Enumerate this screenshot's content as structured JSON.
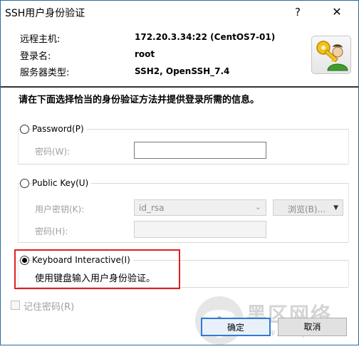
{
  "window": {
    "title": "SSH用户身份验证",
    "help_glyph": "?",
    "close_glyph": "✕"
  },
  "info": {
    "host_label": "远程主机:",
    "host_value": "172.20.3.34:22 (CentOS7-01)",
    "user_label": "登录名:",
    "user_value": "root",
    "server_label": "服务器类型:",
    "server_value": "SSH2, OpenSSH_7.4"
  },
  "instruction": "请在下面选择恰当的身份验证方法并提供登录所需的信息。",
  "password_section": {
    "radio_label": "Password(P)",
    "password_label": "密码(W):",
    "password_value": ""
  },
  "publickey_section": {
    "radio_label": "Public Key(U)",
    "key_label": "用户密钥(K):",
    "key_selected": "id_rsa",
    "browse_label": "浏览(B)...",
    "passphrase_label": "密码(H):",
    "passphrase_value": ""
  },
  "keyboard_section": {
    "radio_label": "Keyboard Interactive(I)",
    "description": "使用键盘输入用户身份验证。",
    "selected": true
  },
  "remember": {
    "label": "记住密码(R)",
    "checked": false
  },
  "buttons": {
    "ok": "确定",
    "cancel": "取消"
  },
  "watermark": {
    "text": "黑区网络",
    "url": "www.heiqu.com"
  },
  "colors": {
    "highlight": "#e02020",
    "ok_border": "#2f7bd0"
  },
  "icons": {
    "key_user": "key-user-icon",
    "watermark_logo": "heiqu-logo-icon"
  }
}
